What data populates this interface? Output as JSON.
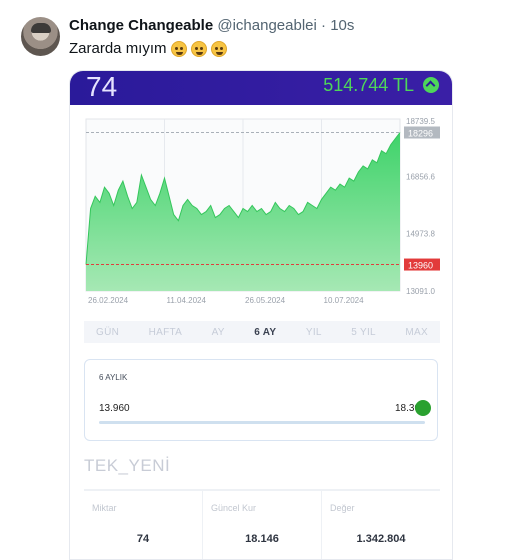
{
  "tweet": {
    "display_name": "Change Changeable",
    "handle": "@ichangeablei",
    "separator": "·",
    "time": "10s",
    "text": "Zararda mıyım",
    "emojis": [
      "pleading-face-icon",
      "thinking-face-icon",
      "tears-of-joy-icon"
    ]
  },
  "app": {
    "quantity": "74",
    "total_value": "514.744 TL",
    "trend_icon": "chevron-up-circle-icon",
    "colors": {
      "header": "#2a1a9a",
      "up": "#4ed65a",
      "line_high": "#a9b0b8",
      "line_low": "#e23b3b"
    },
    "tabs": [
      "GÜN",
      "HAFTA",
      "AY",
      "6 AY",
      "YIL",
      "5 YIL",
      "MAX"
    ],
    "active_tab": "6 AY",
    "range": {
      "label": "6 AYLIK",
      "min": "13.960",
      "max": "18.30"
    },
    "symbol": "TEK_YENİ",
    "stats": [
      {
        "label": "Miktar",
        "value": "74"
      },
      {
        "label": "Güncel Kur",
        "value": "18.146"
      },
      {
        "label": "Değer",
        "value": "1.342.804"
      }
    ]
  },
  "chart_data": {
    "type": "area",
    "x_ticks": [
      "26.02.2024",
      "11.04.2024",
      "26.05.2024",
      "10.07.2024"
    ],
    "y_ticks": [
      "18739.5",
      "16856.6",
      "14973.8",
      "13091.0"
    ],
    "y_tick_values": [
      18739.5,
      16856.6,
      14973.8,
      13091.0
    ],
    "ylim": [
      13091.0,
      18739.5
    ],
    "high_marker": {
      "label": "18296",
      "value": 18296
    },
    "low_marker": {
      "label": "13960",
      "value": 13960
    },
    "y": [
      13960,
      15800,
      16200,
      16000,
      16500,
      16300,
      15900,
      16400,
      16700,
      16200,
      15800,
      16000,
      16900,
      16500,
      16100,
      15900,
      16300,
      16800,
      16200,
      15600,
      15400,
      15900,
      16100,
      15900,
      15800,
      15600,
      15700,
      15900,
      15500,
      15600,
      15800,
      15900,
      15700,
      15500,
      15800,
      15700,
      15900,
      15700,
      15800,
      15600,
      15700,
      16000,
      15800,
      15700,
      15900,
      15800,
      15600,
      15700,
      16000,
      15900,
      15800,
      16100,
      16300,
      16500,
      16400,
      16600,
      16500,
      16800,
      16700,
      17000,
      17200,
      17100,
      17400,
      17300,
      17700,
      17600,
      17900,
      18100,
      18296
    ]
  }
}
